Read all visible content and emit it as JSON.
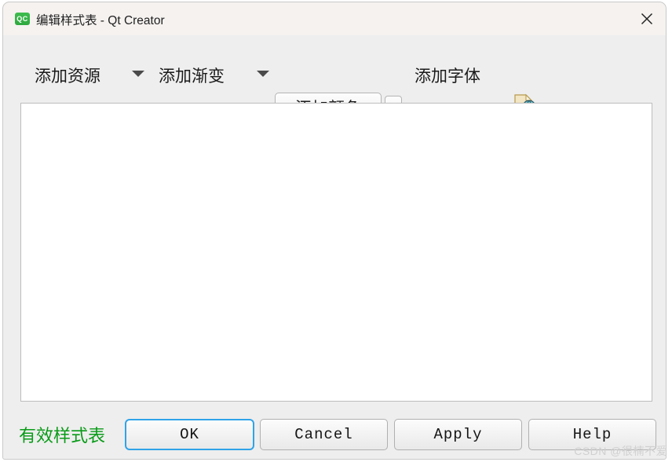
{
  "window": {
    "app_icon_text": "QC",
    "title": "编辑样式表 - Qt Creator",
    "close_icon": "close-icon"
  },
  "toolbar": {
    "add_resource": "添加资源",
    "add_resource_dropdown": "chevron-down-icon",
    "add_gradient": "添加渐变",
    "add_gradient_dropdown": "chevron-down-icon",
    "add_color": "添加颜色",
    "add_color_dropdown": "chevron-down-icon",
    "add_font": "添加字体",
    "preview_icon": "document-magnifier-icon"
  },
  "editor": {
    "value": "",
    "placeholder": ""
  },
  "footer": {
    "status": "有效样式表",
    "status_color": "#0a9b18",
    "ok": "OK",
    "cancel": "Cancel",
    "apply": "Apply",
    "help": "Help"
  },
  "watermark": {
    "text": "CSDN @很楠不爱"
  },
  "colors": {
    "titlebar_bg": "#f5f2f0",
    "dialog_bg": "#eeeeee",
    "editor_bg": "#ffffff",
    "focus_border": "#2fa3e8",
    "accent_green": "#2fa83e"
  }
}
